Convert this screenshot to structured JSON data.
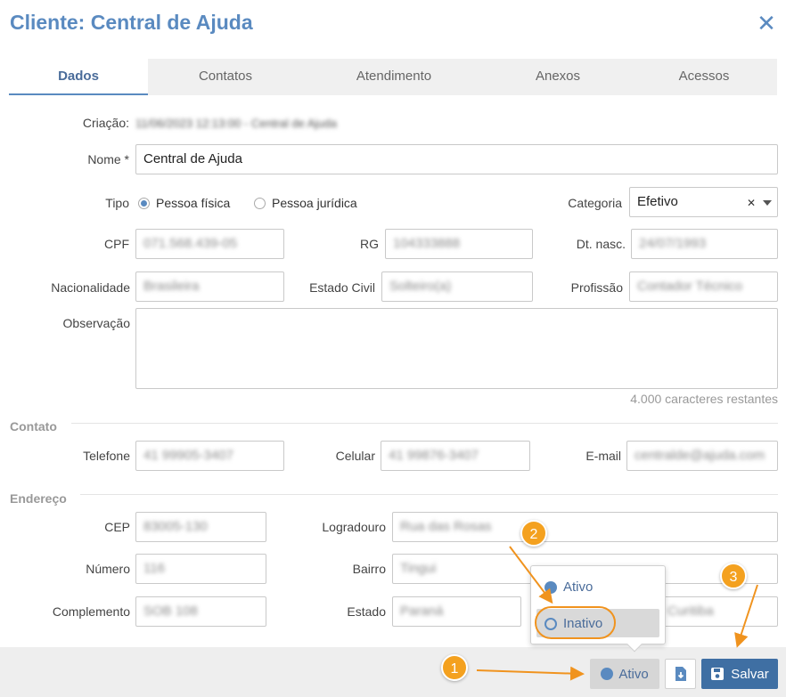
{
  "window": {
    "title": "Cliente: Central de Ajuda",
    "close_icon": "close-icon"
  },
  "tabs": [
    {
      "label": "Dados",
      "active": true
    },
    {
      "label": "Contatos",
      "active": false
    },
    {
      "label": "Atendimento",
      "active": false
    },
    {
      "label": "Anexos",
      "active": false
    },
    {
      "label": "Acessos",
      "active": false
    }
  ],
  "form": {
    "criacao_label": "Criação:",
    "criacao_value": "11/06/2023 12:13:00 - Central de Ajuda",
    "nome_label": "Nome *",
    "nome_value": "Central de Ajuda",
    "tipo_label": "Tipo",
    "tipo_options": [
      "Pessoa física",
      "Pessoa jurídica"
    ],
    "tipo_selected": "Pessoa física",
    "categoria_label": "Categoria",
    "categoria_value": "Efetivo",
    "cpf_label": "CPF",
    "cpf_value": "071.568.439-05",
    "rg_label": "RG",
    "rg_value": "104333888",
    "dtnasc_label": "Dt. nasc.",
    "dtnasc_value": "24/07/1993",
    "nacionalidade_label": "Nacionalidade",
    "nacionalidade_value": "Brasileira",
    "estadocivil_label": "Estado Civil",
    "estadocivil_value": "Solteiro(a)",
    "profissao_label": "Profissão",
    "profissao_value": "Contador Técnico",
    "observacao_label": "Observação",
    "observacao_value": "",
    "counter": "4.000 caracteres restantes"
  },
  "contato": {
    "section_label": "Contato",
    "telefone_label": "Telefone",
    "telefone_value": "41 99905-3407",
    "celular_label": "Celular",
    "celular_value": "41 99876-3407",
    "email_label": "E-mail",
    "email_value": "centralde@ajuda.com"
  },
  "endereco": {
    "section_label": "Endereço",
    "cep_label": "CEP",
    "cep_value": "83005-130",
    "logradouro_label": "Logradouro",
    "logradouro_value": "Rua das Rosas",
    "numero_label": "Número",
    "numero_value": "116",
    "bairro_label": "Bairro",
    "bairro_value": "Tingui",
    "complemento_label": "Complemento",
    "complemento_value": "SOB 108",
    "estado_label": "Estado",
    "estado_value": "Paraná",
    "cidade_value": "Curitiba"
  },
  "status_popup": {
    "options": [
      "Ativo",
      "Inativo"
    ],
    "hover": "Inativo"
  },
  "footer": {
    "status_label": "Ativo",
    "export_icon": "file-export-icon",
    "save_label": "Salvar",
    "save_icon": "floppy-disk-icon"
  },
  "annotations": {
    "badges": [
      "1",
      "2",
      "3"
    ]
  },
  "colors": {
    "accent": "#5a8ac0",
    "primary_button": "#3f6fa3",
    "annotation": "#f4a11f"
  }
}
